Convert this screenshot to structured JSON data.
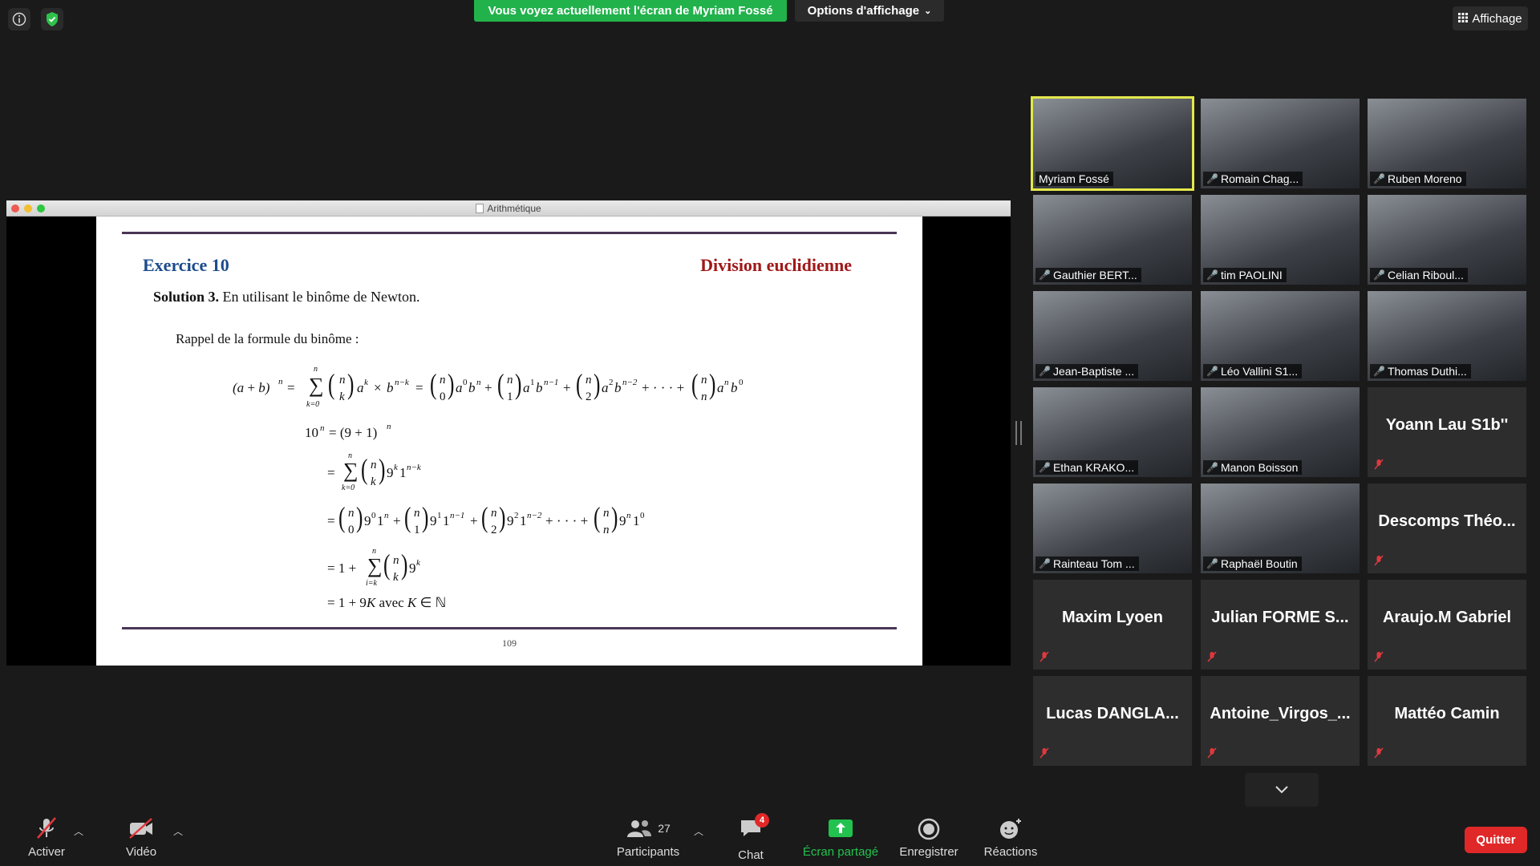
{
  "top": {
    "banner": "Vous voyez actuellement l'écran de Myriam Fossé",
    "view_options": "Options d'affichage",
    "affichage": "Affichage"
  },
  "window": {
    "title": "Arithmétique",
    "exercise": "Exercice 10",
    "topic": "Division euclidienne",
    "solution_label": "Solution 3.",
    "solution_text": "En utilisant le binôme de Newton.",
    "rappel": "Rappel de la formule du binôme :",
    "page_number": "109"
  },
  "participants": [
    {
      "name": "Myriam Fossé",
      "video": true,
      "muted": false,
      "active": true
    },
    {
      "name": "Romain Chag...",
      "video": true,
      "muted": true
    },
    {
      "name": "Ruben Moreno",
      "video": true,
      "muted": true
    },
    {
      "name": "Gauthier BERT...",
      "video": true,
      "muted": true
    },
    {
      "name": "tim PAOLINI",
      "video": true,
      "muted": true
    },
    {
      "name": "Celian Riboul...",
      "video": true,
      "muted": true
    },
    {
      "name": "Jean-Baptiste ...",
      "video": true,
      "muted": true
    },
    {
      "name": "Léo Vallini S1...",
      "video": true,
      "muted": true
    },
    {
      "name": "Thomas Duthi...",
      "video": true,
      "muted": true
    },
    {
      "name": "Ethan KRAKO...",
      "video": true,
      "muted": true
    },
    {
      "name": "Manon Boisson",
      "video": true,
      "muted": true
    },
    {
      "name": "Yoann Lau S1b''",
      "video": false,
      "muted": true
    },
    {
      "name": "Rainteau Tom ...",
      "video": true,
      "muted": true
    },
    {
      "name": "Raphaël Boutin",
      "video": true,
      "muted": true
    },
    {
      "name": "Descomps  Théo...",
      "video": false,
      "muted": true
    },
    {
      "name": "Maxim Lyoen",
      "video": false,
      "muted": true
    },
    {
      "name": "Julian  FORME  S...",
      "video": false,
      "muted": true
    },
    {
      "name": "Araujo.M Gabriel",
      "video": false,
      "muted": true
    },
    {
      "name": "Lucas  DANGLA...",
      "video": false,
      "muted": true
    },
    {
      "name": "Antoine_Virgos_...",
      "video": false,
      "muted": true
    },
    {
      "name": "Mattéo Camin",
      "video": false,
      "muted": true
    }
  ],
  "toolbar": {
    "activer": "Activer",
    "video": "Vidéo",
    "participants": "Participants",
    "participants_count": "27",
    "chat": "Chat",
    "chat_badge": "4",
    "share": "Écran partagé",
    "record": "Enregistrer",
    "reactions": "Réactions",
    "quit": "Quitter"
  },
  "colors": {
    "banner_green": "#22b24c",
    "active_speaker": "#e3e84c",
    "quit_red": "#e02828",
    "exercise_blue": "#1c4b8c",
    "topic_red": "#a01818"
  }
}
